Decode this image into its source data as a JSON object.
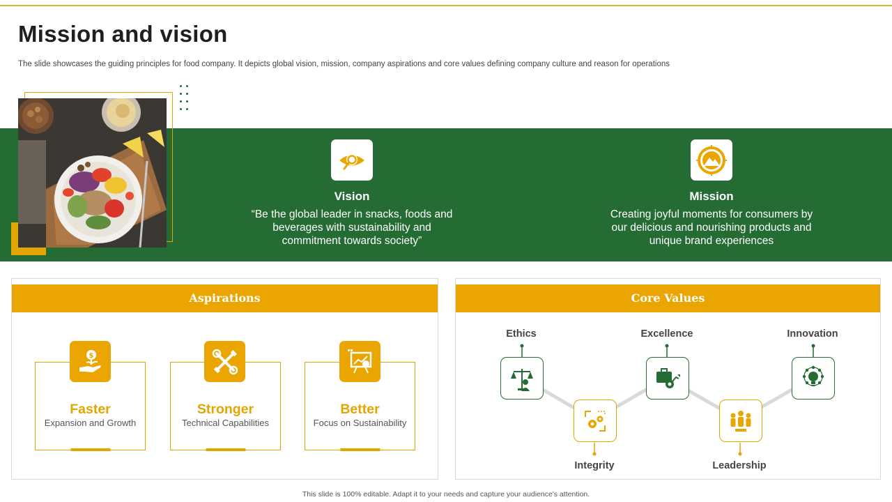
{
  "page": {
    "title": "Mission and vision",
    "subtitle": "The slide showcases the guiding principles for food company. It depicts global vision, mission, company aspirations and core values defining company culture and reason for operations",
    "footer": "This slide is 100% editable. Adapt it to your needs and capture your audience's attention."
  },
  "vision": {
    "icon": "eye-search-icon",
    "heading": "Vision",
    "text_lines": [
      "“Be the global leader in snacks, foods and",
      "beverages with sustainability and",
      "commitment towards society”"
    ]
  },
  "mission": {
    "icon": "target-mountain-icon",
    "heading": "Mission",
    "text_lines": [
      "Creating joyful moments for consumers by",
      "our delicious and nourishing products and",
      "unique brand experiences"
    ]
  },
  "aspirations": {
    "heading": "Aspirations",
    "items": [
      {
        "title": "Faster",
        "subtitle": "Expansion and Growth",
        "icon": "money-hand-icon"
      },
      {
        "title": "Stronger",
        "subtitle": "Technical Capabilities",
        "icon": "tools-cross-icon"
      },
      {
        "title": "Better",
        "subtitle": "Focus on Sustainability",
        "icon": "presentation-chart-icon"
      }
    ]
  },
  "core_values": {
    "heading": "Core Values",
    "items": [
      {
        "label": "Ethics",
        "icon": "scale-person-icon",
        "color": "green"
      },
      {
        "label": "Integrity",
        "icon": "gears-arrows-icon",
        "color": "gold"
      },
      {
        "label": "Excellence",
        "icon": "briefcase-growth-icon",
        "color": "green"
      },
      {
        "label": "Leadership",
        "icon": "team-leader-icon",
        "color": "gold"
      },
      {
        "label": "Innovation",
        "icon": "lightbulb-network-icon",
        "color": "green"
      }
    ]
  },
  "colors": {
    "green": "#256b34",
    "gold": "#eba500",
    "accent_line": "#d4b82a"
  }
}
